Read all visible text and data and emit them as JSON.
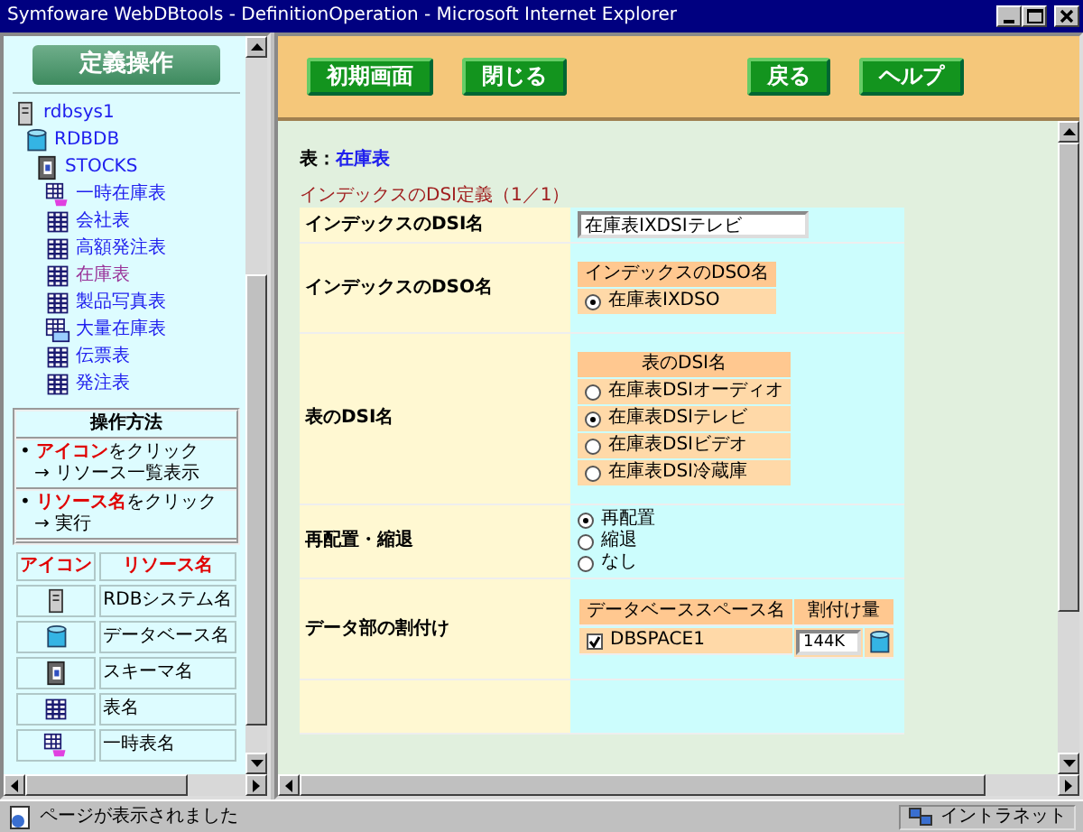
{
  "window": {
    "title": "Symfoware WebDBtools - DefinitionOperation - Microsoft Internet Explorer"
  },
  "sidebar": {
    "header": "定義操作",
    "tree": [
      {
        "label": "rdbsys1",
        "kind": "server",
        "selected": false,
        "children": [
          {
            "label": "RDBDB",
            "kind": "database",
            "selected": false,
            "children": [
              {
                "label": "STOCKS",
                "kind": "schema",
                "selected": false,
                "children": [
                  {
                    "label": "一時在庫表",
                    "kind": "temp",
                    "selected": false
                  },
                  {
                    "label": "会社表",
                    "kind": "table",
                    "selected": false
                  },
                  {
                    "label": "高額発注表",
                    "kind": "table",
                    "selected": false
                  },
                  {
                    "label": "在庫表",
                    "kind": "table",
                    "selected": true
                  },
                  {
                    "label": "製品写真表",
                    "kind": "table",
                    "selected": false
                  },
                  {
                    "label": "大量在庫表",
                    "kind": "large",
                    "selected": false
                  },
                  {
                    "label": "伝票表",
                    "kind": "table",
                    "selected": false
                  },
                  {
                    "label": "発注表",
                    "kind": "table",
                    "selected": false
                  }
                ]
              }
            ]
          }
        ]
      }
    ],
    "help": {
      "title": "操作方法",
      "items": [
        {
          "bullet": "•",
          "highlight": "アイコン",
          "text": "をクリック",
          "result": "→ リソース一覧表示"
        },
        {
          "bullet": "•",
          "highlight": "リソース名",
          "text": "をクリック",
          "result": "→ 実行"
        }
      ]
    },
    "legend": {
      "columns": [
        "アイコン",
        "リソース名"
      ],
      "rows": [
        {
          "kind": "server",
          "label": "RDBシステム名"
        },
        {
          "kind": "database",
          "label": "データベース名"
        },
        {
          "kind": "schema",
          "label": "スキーマ名"
        },
        {
          "kind": "table",
          "label": "表名"
        },
        {
          "kind": "temp",
          "label": "一時表名"
        }
      ]
    }
  },
  "toolbar": {
    "left": [
      "初期画面",
      "閉じる"
    ],
    "right": [
      "戻る",
      "ヘルプ"
    ]
  },
  "content": {
    "table_label": "表：",
    "table_name": "在庫表",
    "section_title": "インデックスのDSI定義（1／1）",
    "rows": [
      {
        "kind": "text",
        "label": "インデックスのDSI名",
        "value": "在庫表IXDSIテレビ"
      },
      {
        "kind": "radio_group",
        "label": "インデックスのDSO名",
        "header": "インデックスのDSO名",
        "options": [
          {
            "label": "在庫表IXDSO",
            "selected": true
          }
        ]
      },
      {
        "kind": "radio_group",
        "label": "表のDSI名",
        "header": "表のDSI名",
        "options": [
          {
            "label": "在庫表DSIオーディオ",
            "selected": false
          },
          {
            "label": "在庫表DSIテレビ",
            "selected": true
          },
          {
            "label": "在庫表DSIビデオ",
            "selected": false
          },
          {
            "label": "在庫表DSI冷蔵庫",
            "selected": false
          }
        ]
      },
      {
        "kind": "radio_plain",
        "label": "再配置・縮退",
        "options": [
          {
            "label": "再配置",
            "selected": true
          },
          {
            "label": "縮退",
            "selected": false
          },
          {
            "label": "なし",
            "selected": false
          }
        ]
      },
      {
        "kind": "allocation",
        "label": "データ部の割付け",
        "columns": [
          "データベーススペース名",
          "割付け量"
        ],
        "items": [
          {
            "name": "DBSPACE1",
            "checked": true,
            "amount": "144K"
          }
        ]
      }
    ]
  },
  "status_bar": {
    "message": "ページが表示されました",
    "zone": "イントラネット"
  }
}
